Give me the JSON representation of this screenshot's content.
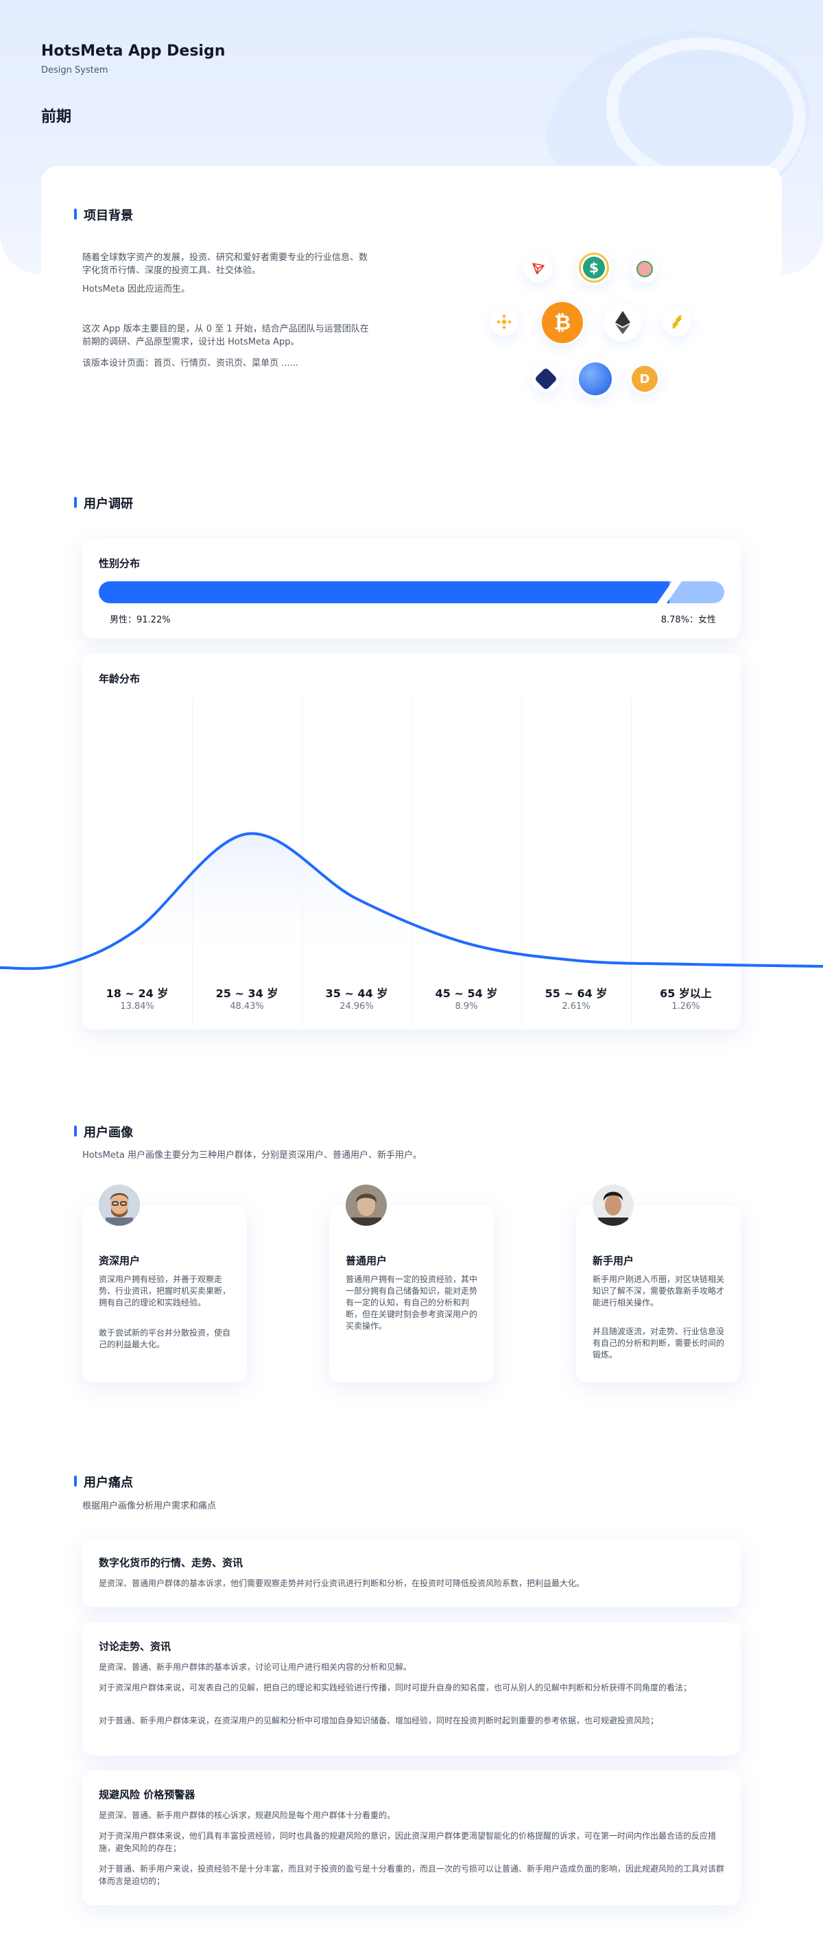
{
  "header": {
    "brand_title": "HotsMeta App Design",
    "brand_subtitle": "Design System",
    "phase_title": "前期"
  },
  "background": {
    "title": "项目背景",
    "paragraphs": [
      "随着全球数字资产的发展，投资、研究和爱好者需要专业的行业信息、数字化货币行情、深度的投资工具、社交体验。",
      "HotsMeta 因此应运而生。",
      "这次 App 版本主要目的是，从 0 至 1 开始，结合产品团队与运营团队在前期的调研、产品原型需求，设计出 HotsMeta App。",
      "该版本设计页面：首页、行情页、资讯页、菜单页 ......"
    ],
    "coins": [
      "tron-icon",
      "usd-coin-icon",
      "pig-token-icon",
      "bnb-icon",
      "bitcoin-icon",
      "ethereum-icon",
      "binance-usd-icon",
      "wbtc-icon",
      "blue-token-icon",
      "dai-icon"
    ]
  },
  "research": {
    "title": "用户调研",
    "gender": {
      "title": "性别分布",
      "male_label": "男性：91.22%",
      "female_label": "8.78%：女性",
      "male_share": 91.22,
      "female_share": 8.78
    },
    "age": {
      "title": "年龄分布",
      "groups": [
        {
          "label": "18 ~ 24 岁",
          "pct": "13.84%",
          "value": 13.84
        },
        {
          "label": "25 ~ 34 岁",
          "pct": "48.43%",
          "value": 48.43
        },
        {
          "label": "35 ~ 44 岁",
          "pct": "24.96%",
          "value": 24.96
        },
        {
          "label": "45 ~ 54 岁",
          "pct": "8.9%",
          "value": 8.9
        },
        {
          "label": "55 ~ 64 岁",
          "pct": "2.61%",
          "value": 2.61
        },
        {
          "label": "65 岁以上",
          "pct": "1.26%",
          "value": 1.26
        }
      ],
      "colors": {
        "line": "#1f6bff",
        "fill": "#e8f0ff"
      }
    }
  },
  "personas": {
    "title": "用户画像",
    "description": "HotsMeta 用户画像主要分为三种用户群体，分别是资深用户、普通用户、新手用户。",
    "items": [
      {
        "name": "资深用户",
        "text1": "资深用户拥有经验，并善于观察走势、行业资讯，把握时机买卖果断，拥有自己的理论和实践经验。",
        "text2": "敢于尝试新的平台并分散投资，使自己的利益最大化。"
      },
      {
        "name": "普通用户",
        "text1": "普通用户拥有一定的投资经验，其中一部分拥有自己储备知识，能对走势有一定的认知，有自己的分析和判断，但在关键时刻会参考资深用户的买卖操作。",
        "text2": ""
      },
      {
        "name": "新手用户",
        "text1": "新手用户刚进入币圈，对区块链相关知识了解不深，需要依靠新手攻略才能进行相关操作。",
        "text2": "并且随波逐流，对走势、行业信息没有自己的分析和判断，需要长时间的锻炼。"
      }
    ]
  },
  "pain_points": {
    "title": "用户痛点",
    "description": "根据用户画像分析用户需求和痛点",
    "items": [
      {
        "title": "数字化货币的行情、走势、资讯",
        "lines": [
          "是资深、普通用户群体的基本诉求，他们需要观察走势并对行业资讯进行判断和分析，在投资时可降低投资风险系数，把利益最大化。"
        ]
      },
      {
        "title": "讨论走势、资讯",
        "lines": [
          "是资深、普通、新手用户群体的基本诉求，讨论可让用户进行相关内容的分析和见解。",
          "对于资深用户群体来说，可发表自己的见解，把自己的理论和实践经验进行传播，同时可提升自身的知名度，也可从别人的见解中判断和分析获得不同角度的看法；",
          "对于普通、新手用户群体来说，在资深用户的见解和分析中可增加自身知识储备、增加经验，同时在投资判断时起到重要的参考依据，也可规避投资风险；"
        ]
      },
      {
        "title": "规避风险 价格预警器",
        "lines": [
          "是资深、普通、新手用户群体的核心诉求，规避风险是每个用户群体十分看重的。",
          "对于资深用户群体来说，他们具有丰富投资经验，同时也具备的规避风险的意识，因此资深用户群体更渴望智能化的价格提醒的诉求，可在第一时间内作出最合适的反应措施，避免风险的存在；",
          "对于普通、新手用户来说，投资经验不是十分丰富，而且对于投资的盈亏是十分看重的，而且一次的亏损可以让普通、新手用户造成负面的影响，因此规避风险的工具对该群体而言是迫切的；"
        ]
      }
    ]
  }
}
